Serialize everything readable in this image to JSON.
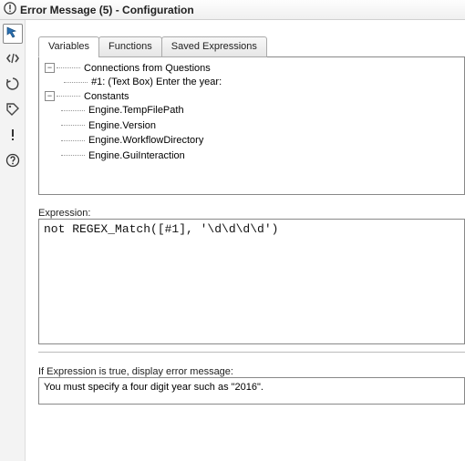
{
  "window": {
    "title": "Error Message (5) - Configuration"
  },
  "tool_icons": [
    "arrow-icon",
    "code-icon",
    "refresh-icon",
    "tag-icon",
    "alert-icon",
    "help-icon"
  ],
  "tabs": [
    {
      "label": "Variables",
      "active": true
    },
    {
      "label": "Functions",
      "active": false
    },
    {
      "label": "Saved Expressions",
      "active": false
    }
  ],
  "tree": {
    "nodes": [
      {
        "label": "Connections from Questions",
        "children": [
          {
            "label": "#1: (Text Box) Enter the year:"
          }
        ]
      },
      {
        "label": "Constants",
        "children": [
          {
            "label": "Engine.TempFilePath"
          },
          {
            "label": "Engine.Version"
          },
          {
            "label": "Engine.WorkflowDirectory"
          },
          {
            "label": "Engine.GuiInteraction"
          }
        ]
      }
    ]
  },
  "expression_label": "Expression:",
  "expression_value": "not REGEX_Match([#1], '\\d\\d\\d\\d')",
  "error_label": "If Expression is true, display error message:",
  "error_value": "You must specify a four digit year such as \"2016\"."
}
